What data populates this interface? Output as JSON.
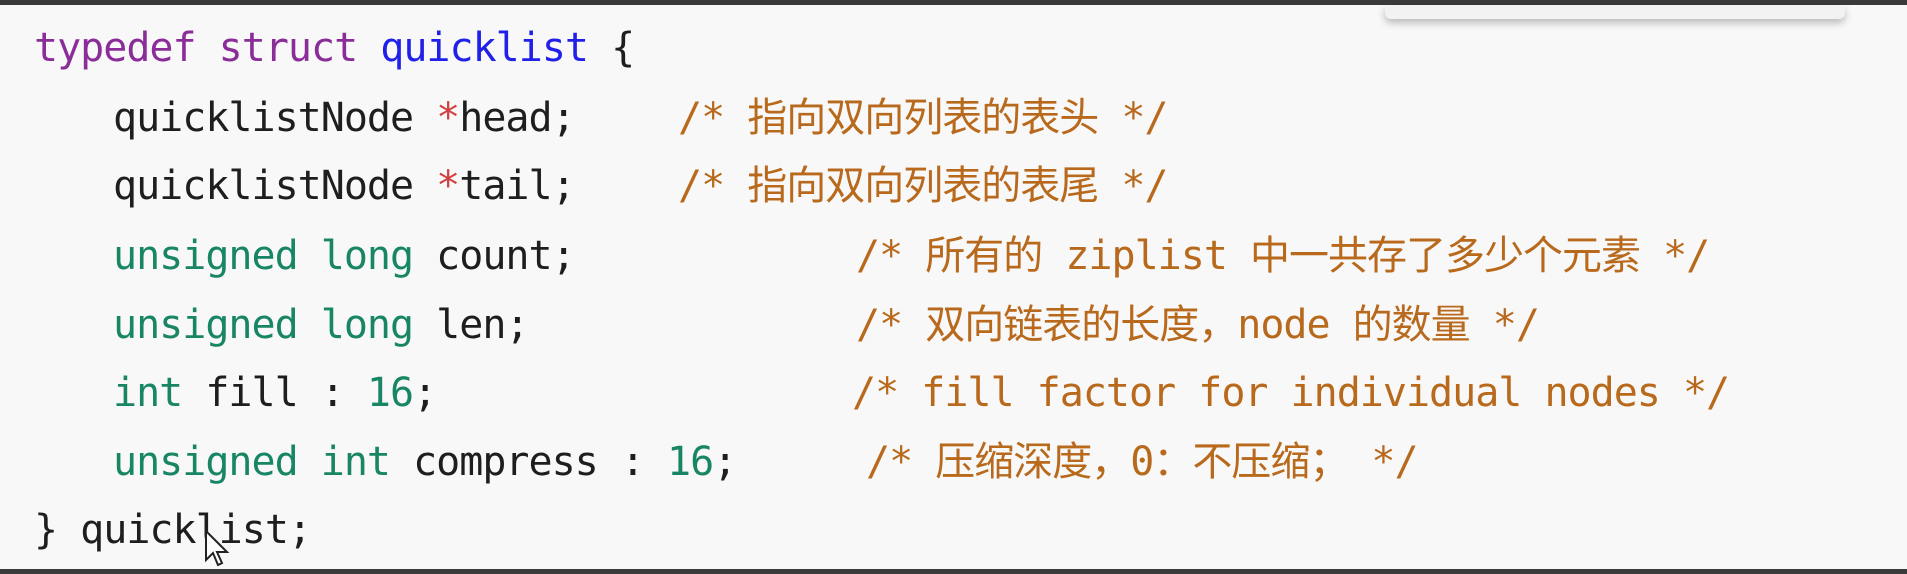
{
  "code": {
    "line1": {
      "typedef": "typedef",
      "struct": "struct",
      "name": "quicklist",
      "brace": " {"
    },
    "line2": {
      "type": "quicklistNode ",
      "star": "*",
      "field": "head;",
      "comment": "/* 指向双向列表的表头 */"
    },
    "line3": {
      "type": "quicklistNode ",
      "star": "*",
      "field": "tail;",
      "comment": "/* 指向双向列表的表尾 */"
    },
    "line4": {
      "kw1": "unsigned",
      "kw2": "long",
      "field": "count;",
      "comment": "/* 所有的 ziplist 中一共存了多少个元素 */"
    },
    "line5": {
      "kw1": "unsigned",
      "kw2": "long",
      "field": "len;",
      "comment": "/* 双向链表的长度，node 的数量 */"
    },
    "line6": {
      "kw1": "int",
      "field": "fill : ",
      "num": "16",
      "semi": ";",
      "comment": "/* fill factor for individual nodes */"
    },
    "line7": {
      "kw1": "unsigned",
      "kw2": "int",
      "field": "compress : ",
      "num": "16",
      "semi": ";",
      "comment": "/* 压缩深度，0：不压缩； */"
    },
    "line8": {
      "text": "} quicklist;"
    }
  },
  "colors": {
    "keyword_purple": "#8a2d99",
    "type_blue": "#2020e8",
    "keyword_green": "#188565",
    "comment": "#b8691c",
    "background": "#f8f8f8"
  }
}
